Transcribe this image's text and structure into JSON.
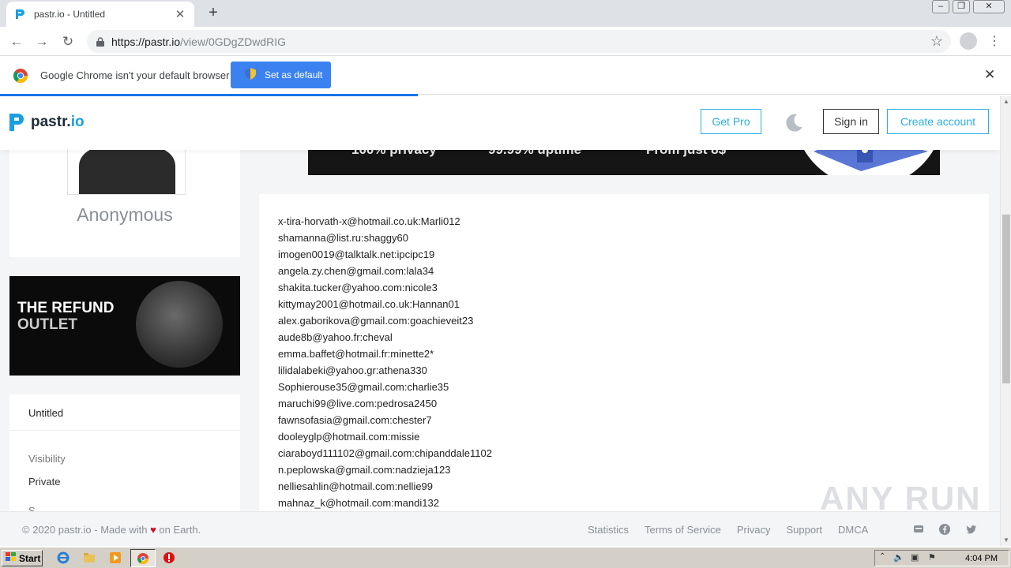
{
  "browser": {
    "tab_title": "pastr.io - Untitled",
    "url_host": "https://pastr.io",
    "url_path": "/view/0GDgZDwdRIG"
  },
  "infobar": {
    "message": "Google Chrome isn't your default browser",
    "button_label": "Set as default"
  },
  "site": {
    "logo_text": "pastr.",
    "logo_suffix": "io",
    "get_pro": "Get Pro",
    "sign_in": "Sign in",
    "create_account": "Create account",
    "accent_color": "#2ab0e6"
  },
  "sidebar": {
    "author": "Anonymous",
    "ad_line1": "THE REFUND",
    "ad_line2": "OUTLET",
    "paste_title": "Untitled",
    "visibility_label": "Visibility",
    "visibility_value": "Private",
    "cut_label": "S..."
  },
  "banner": {
    "feature1": "100% privacy",
    "feature2": "99.99% uptime",
    "feature3": "From just 8$"
  },
  "paste": {
    "lines": [
      "x-tira-horvath-x@hotmail.co.uk:Marli012",
      "shamanna@list.ru:shaggy60",
      "imogen0019@talktalk.net:ipcipc19",
      "angela.zy.chen@gmail.com:lala34",
      "shakita.tucker@yahoo.com:nicole3",
      "kittymay2001@hotmail.co.uk:Hannan01",
      "alex.gaborikova@gmail.com:goachieveit23",
      "aude8b@yahoo.fr:cheval",
      "emma.baffet@hotmail.fr:minette2*",
      "lilidalabeki@yahoo.gr:athena330",
      "Sophierouse35@gmail.com:charlie35",
      "maruchi99@live.com:pedrosa2450",
      "fawnsofasia@gmail.com:chester7",
      "dooleyglp@hotmail.com:missie",
      "ciaraboyd111102@gmail.com:chipanddale1102",
      "n.peplowska@gmail.com:nadzieja123",
      "nelliesahlin@hotmail.com:nellie99",
      "mahnaz_k@hotmail.com:mandi132"
    ]
  },
  "footer": {
    "copyright_pre": "© 2020 pastr.io - Made with",
    "copyright_post": "on Earth.",
    "links": [
      "Statistics",
      "Terms of Service",
      "Privacy",
      "Support",
      "DMCA"
    ]
  },
  "watermark": "ANY RUN",
  "taskbar": {
    "start_label": "Start",
    "clock": "4:04 PM"
  }
}
